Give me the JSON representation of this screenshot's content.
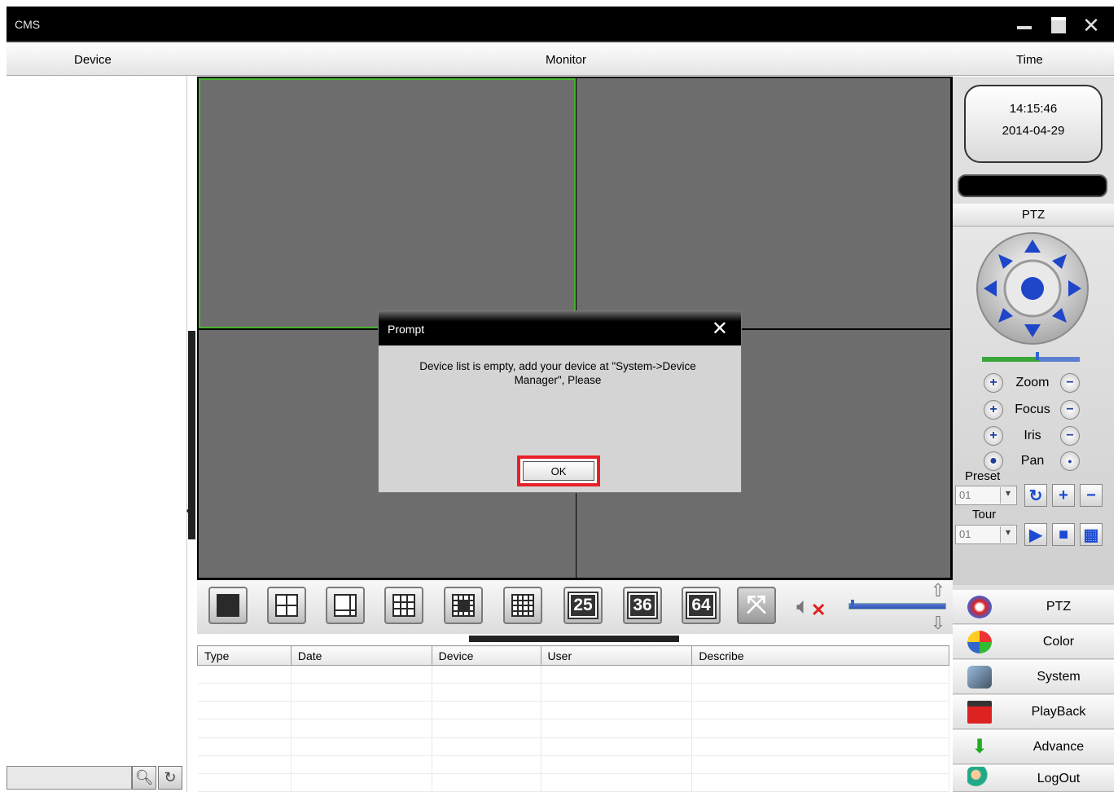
{
  "window": {
    "title": "CMS"
  },
  "header": {
    "device": "Device",
    "monitor": "Monitor",
    "time": "Time"
  },
  "clock": {
    "time": "14:15:46",
    "date": "2014-04-29"
  },
  "ptz": {
    "header": "PTZ",
    "controls": [
      "Zoom",
      "Focus",
      "Iris",
      "Pan"
    ],
    "preset_label": "Preset",
    "preset_value": "01",
    "tour_label": "Tour",
    "tour_value": "01"
  },
  "layout_buttons": [
    "1",
    "4",
    "8",
    "9",
    "13",
    "16",
    "25",
    "36",
    "64"
  ],
  "log_table": {
    "columns": [
      "Type",
      "Date",
      "Device",
      "User",
      "Describe"
    ]
  },
  "nav": [
    {
      "label": "PTZ",
      "icon": "ptz-icon"
    },
    {
      "label": "Color",
      "icon": "color-icon"
    },
    {
      "label": "System",
      "icon": "system-icon"
    },
    {
      "label": "PlayBack",
      "icon": "playback-icon"
    },
    {
      "label": "Advance",
      "icon": "advance-icon"
    },
    {
      "label": "LogOut",
      "icon": "logout-icon"
    }
  ],
  "dialog": {
    "title": "Prompt",
    "message": "Device list is empty, add your device at \"System->Device Manager\", Please",
    "ok": "OK"
  },
  "colors": {
    "highlight": "#e8202a",
    "active_cell": "#47b42e"
  }
}
